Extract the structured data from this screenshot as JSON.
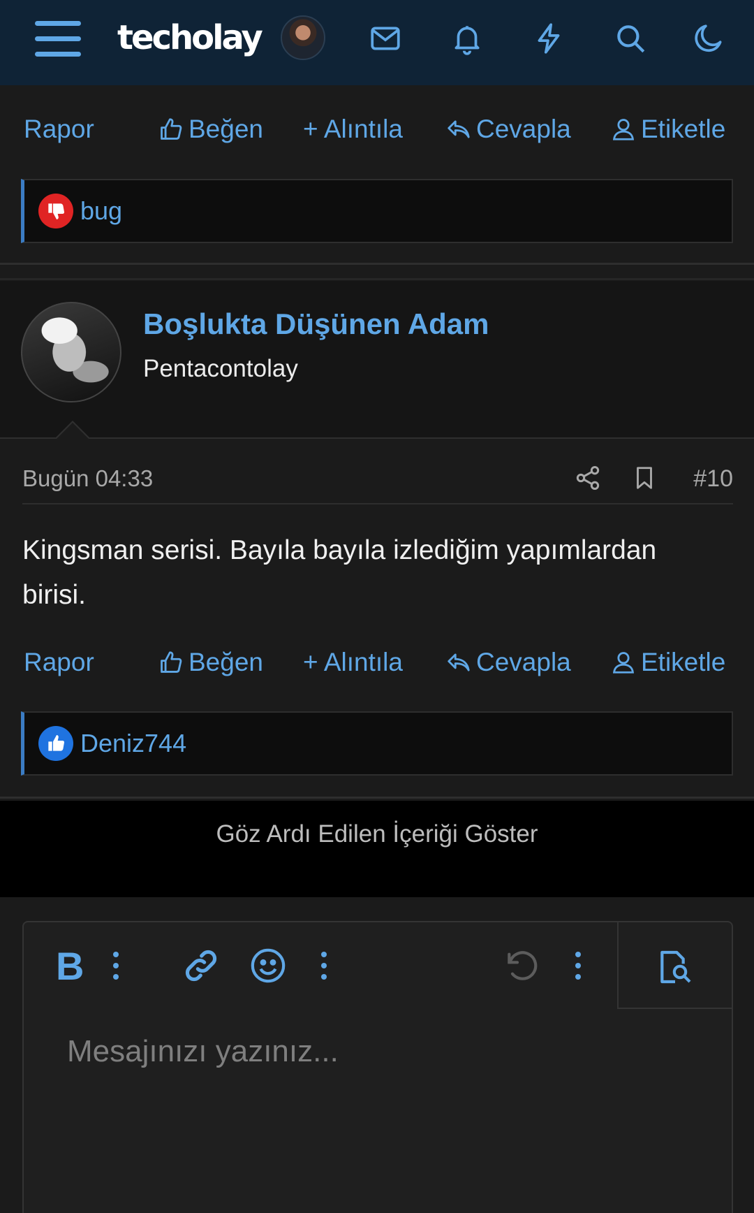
{
  "nav": {
    "logo": "techolay",
    "icons": [
      "menu-icon",
      "mail-icon",
      "bell-icon",
      "lightning-icon",
      "search-icon",
      "moon-icon"
    ]
  },
  "actions": {
    "report": "Rapor",
    "like": "Beğen",
    "quote": "+ Alıntıla",
    "reply": "Cevapla",
    "tag": "Etiketle"
  },
  "prev_post": {
    "reaction_user": "bug",
    "reaction_type": "dislike"
  },
  "post": {
    "username": "Boşlukta Düşünen Adam",
    "user_title": "Pentacontolay",
    "date": "Bugün 04:33",
    "number": "#10",
    "message": "Kingsman serisi. Bayıla bayıla izlediğim yapımlardan birisi.",
    "reaction_user": "Deniz744",
    "reaction_type": "like"
  },
  "ignored_label": "Göz Ardı Edilen İçeriği Göster",
  "editor": {
    "placeholder": "Mesajınızı yazınız...",
    "tools": [
      "bold-icon",
      "more-icon",
      "link-icon",
      "emoji-icon",
      "more-icon",
      "undo-icon",
      "more-icon",
      "preview-icon"
    ]
  },
  "colors": {
    "accent": "#5fa7e6",
    "nav_bg": "#0f2336",
    "dislike": "#e02424",
    "like": "#1f73e0"
  }
}
